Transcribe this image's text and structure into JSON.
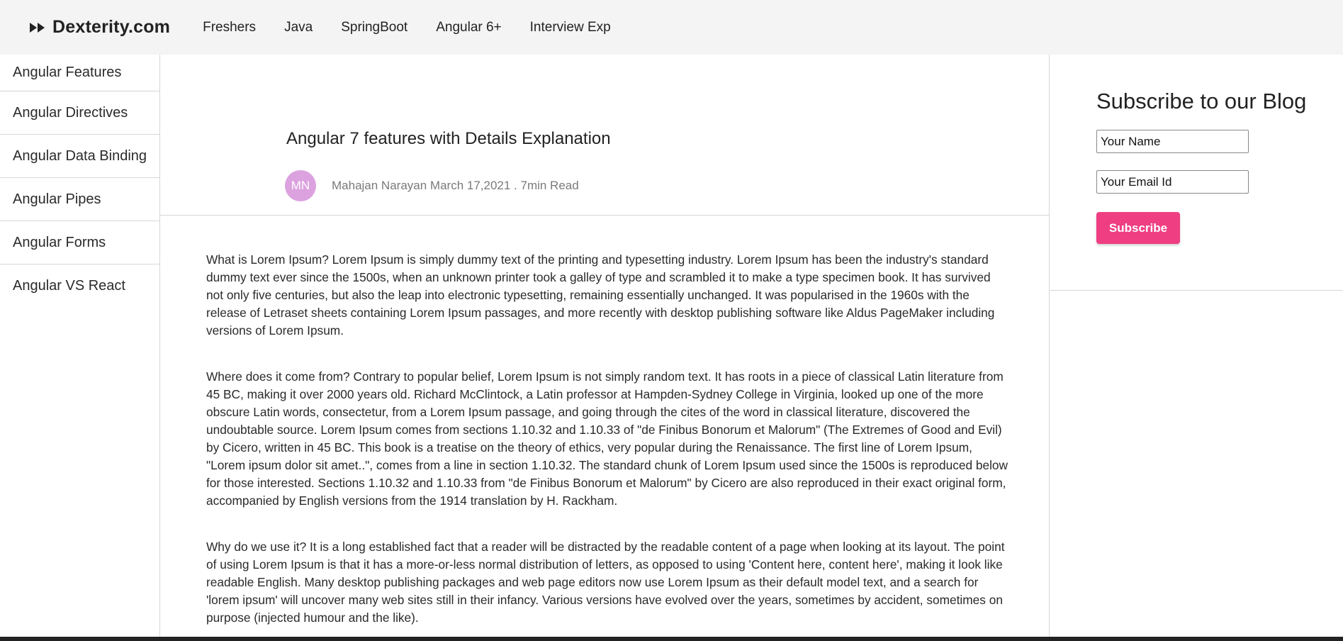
{
  "header": {
    "brand": "Dexterity.com",
    "brand_icon": "fast-forward-icon",
    "nav": [
      "Freshers",
      "Java",
      "SpringBoot",
      "Angular 6+",
      "Interview Exp"
    ]
  },
  "sidebar": {
    "items": [
      "Angular Features",
      "Angular Directives",
      "Angular Data Binding",
      "Angular Pipes",
      "Angular Forms",
      "Angular VS React"
    ]
  },
  "article": {
    "title": "Angular 7 features with Details Explanation",
    "avatar_initials": "MN",
    "meta": "Mahajan Narayan March 17,2021 . 7min Read",
    "paragraphs": [
      "What is Lorem Ipsum? Lorem Ipsum is simply dummy text of the printing and typesetting industry. Lorem Ipsum has been the industry's standard dummy text ever since the 1500s, when an unknown printer took a galley of type and scrambled it to make a type specimen book. It has survived not only five centuries, but also the leap into electronic typesetting, remaining essentially unchanged. It was popularised in the 1960s with the release of Letraset sheets containing Lorem Ipsum passages, and more recently with desktop publishing software like Aldus PageMaker including versions of Lorem Ipsum.",
      "Where does it come from? Contrary to popular belief, Lorem Ipsum is not simply random text. It has roots in a piece of classical Latin literature from 45 BC, making it over 2000 years old. Richard McClintock, a Latin professor at Hampden-Sydney College in Virginia, looked up one of the more obscure Latin words, consectetur, from a Lorem Ipsum passage, and going through the cites of the word in classical literature, discovered the undoubtable source. Lorem Ipsum comes from sections 1.10.32 and 1.10.33 of \"de Finibus Bonorum et Malorum\" (The Extremes of Good and Evil) by Cicero, written in 45 BC. This book is a treatise on the theory of ethics, very popular during the Renaissance. The first line of Lorem Ipsum, \"Lorem ipsum dolor sit amet..\", comes from a line in section 1.10.32. The standard chunk of Lorem Ipsum used since the 1500s is reproduced below for those interested. Sections 1.10.32 and 1.10.33 from \"de Finibus Bonorum et Malorum\" by Cicero are also reproduced in their exact original form, accompanied by English versions from the 1914 translation by H. Rackham.",
      "Why do we use it? It is a long established fact that a reader will be distracted by the readable content of a page when looking at its layout. The point of using Lorem Ipsum is that it has a more-or-less normal distribution of letters, as opposed to using 'Content here, content here', making it look like readable English. Many desktop publishing packages and web page editors now use Lorem Ipsum as their default model text, and a search for 'lorem ipsum' will uncover many web sites still in their infancy. Various versions have evolved over the years, sometimes by accident, sometimes on purpose (injected humour and the like)."
    ]
  },
  "subscribe": {
    "title": "Subscribe to our Blog",
    "name_placeholder": "Your Name",
    "email_placeholder": "Your Email Id",
    "button": "Subscribe",
    "button_color": "#ef3e82"
  },
  "colors": {
    "avatar": "#dca2e0",
    "topbar": "#f4f4f4"
  }
}
